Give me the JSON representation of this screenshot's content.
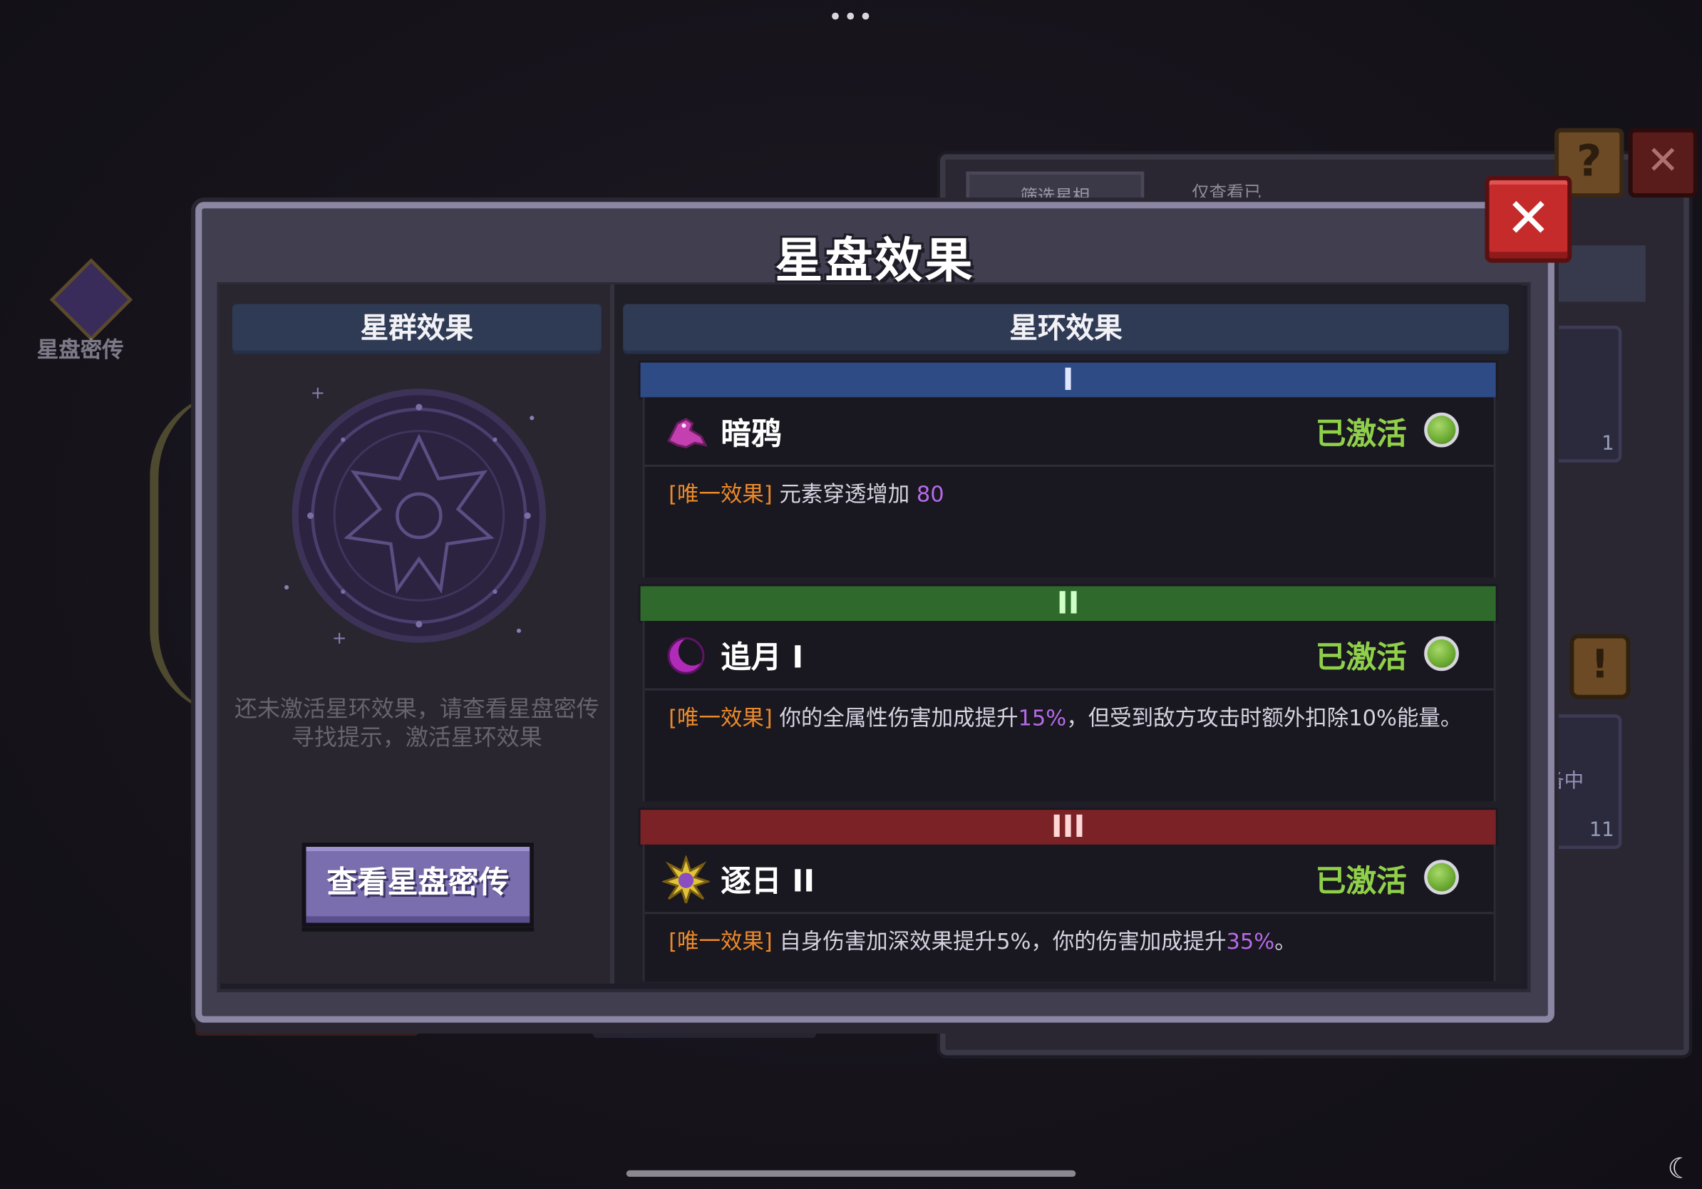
{
  "system": {
    "top_dots": "•••",
    "moon_icon": "☾"
  },
  "background": {
    "side_label": "星盘密传",
    "tab1": "筛选星相",
    "tab2": "仅查看已",
    "help": "?",
    "close": "✕",
    "exclaim": "!",
    "card1_count": "1",
    "card2_text": "备中",
    "card2_count": "11"
  },
  "dialog": {
    "title": "星盘效果",
    "close_glyph": "✕",
    "left": {
      "header": "星群效果",
      "hint": "还未激活星环效果，请查看星盘密传寻找提示，激活星环效果",
      "button": "查看星盘密传"
    },
    "right": {
      "header": "星环效果",
      "rings": [
        {
          "numeral": "I",
          "color": "#2e4b86",
          "name": "暗鸦",
          "icon": "crow-icon",
          "status": "已激活",
          "tag": "[唯一效果]",
          "desc_pre": "元素穿透增加 ",
          "desc_num1": "80",
          "desc_mid": "",
          "desc_num2": "",
          "desc_post": ""
        },
        {
          "numeral": "II",
          "color": "#2f6a2c",
          "name": "追月 I",
          "icon": "crescent-moon-icon",
          "status": "已激活",
          "tag": "[唯一效果]",
          "desc_pre": "你的全属性伤害加成提升",
          "desc_num1": "15%",
          "desc_mid": "，但受到敌方攻击时额外扣除10%能量。",
          "desc_num2": "",
          "desc_post": ""
        },
        {
          "numeral": "III",
          "color": "#7a2226",
          "name": "逐日 II",
          "icon": "sun-icon",
          "status": "已激活",
          "tag": "[唯一效果]",
          "desc_pre": "自身伤害加深效果提升5%，你的伤害加成提升",
          "desc_num1": "35%",
          "desc_mid": "。",
          "desc_num2": "",
          "desc_post": ""
        }
      ]
    }
  }
}
